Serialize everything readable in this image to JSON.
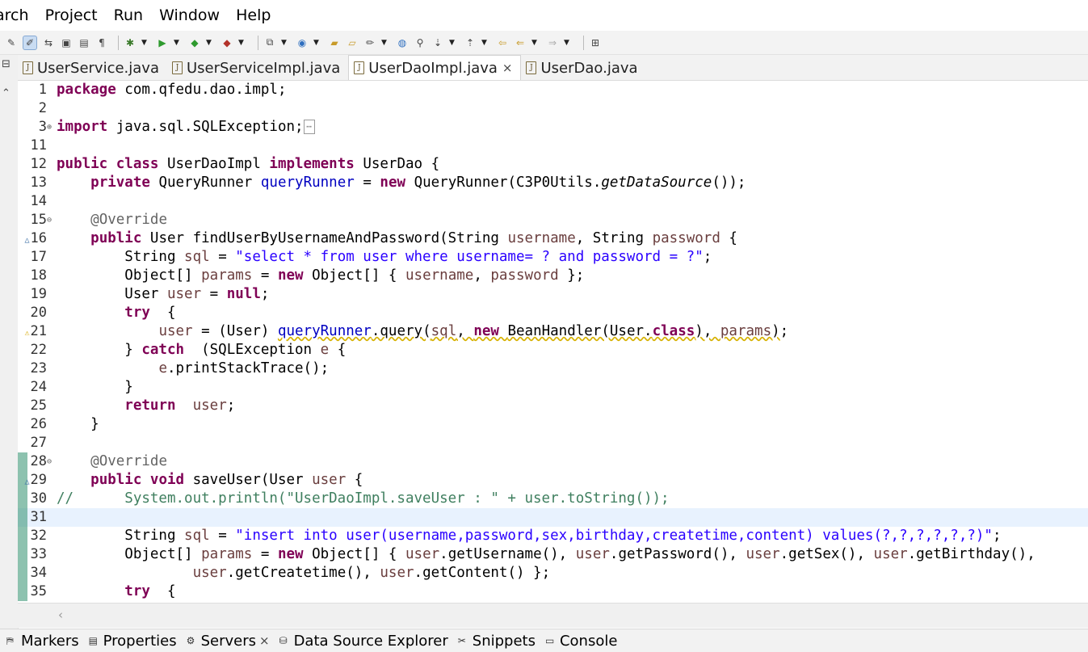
{
  "menu": {
    "items": [
      "arch",
      "Project",
      "Run",
      "Window",
      "Help"
    ]
  },
  "tabs": [
    {
      "label": "UserService.java",
      "active": false
    },
    {
      "label": "UserServiceImpl.java",
      "active": false
    },
    {
      "label": "UserDaoImpl.java",
      "active": true,
      "closable": true
    },
    {
      "label": "UserDao.java",
      "active": false
    }
  ],
  "code": [
    {
      "n": "1",
      "segs": [
        [
          "kw",
          "package"
        ],
        [
          "",
          "com.qfedu.dao.impl;"
        ]
      ]
    },
    {
      "n": "2",
      "segs": []
    },
    {
      "n": "3",
      "fold": "⊕",
      "segs": [
        [
          "kw",
          "import"
        ],
        [
          "",
          "java.sql.SQLException;"
        ],
        [
          "box",
          "⋯"
        ]
      ]
    },
    {
      "n": "11",
      "segs": []
    },
    {
      "n": "12",
      "segs": [
        [
          "kw",
          "public class"
        ],
        [
          "",
          "UserDaoImpl "
        ],
        [
          "kw",
          "implements"
        ],
        [
          "",
          "UserDao {"
        ]
      ]
    },
    {
      "n": "13",
      "segs": [
        [
          "",
          "    "
        ],
        [
          "kw",
          "private"
        ],
        [
          "",
          "QueryRunner "
        ],
        [
          "fld",
          "queryRunner"
        ],
        [
          "",
          " = "
        ],
        [
          "kw",
          "new"
        ],
        [
          "",
          "QueryRunner(C3P0Utils."
        ],
        [
          "ital",
          "getDataSource"
        ],
        [
          "",
          "());"
        ]
      ]
    },
    {
      "n": "14",
      "segs": []
    },
    {
      "n": "15",
      "fold": "⊖",
      "segs": [
        [
          "",
          "    "
        ],
        [
          "ann",
          "@Override"
        ]
      ]
    },
    {
      "n": "16",
      "marker": "△",
      "segs": [
        [
          "",
          "    "
        ],
        [
          "kw",
          "public"
        ],
        [
          "",
          "User findUserByUsernameAndPassword(String "
        ],
        [
          "var",
          "username"
        ],
        [
          "",
          ", String "
        ],
        [
          "var",
          "password"
        ],
        [
          "",
          " {"
        ]
      ]
    },
    {
      "n": "17",
      "segs": [
        [
          "",
          "        String "
        ],
        [
          "var",
          "sql"
        ],
        [
          "",
          " = "
        ],
        [
          "str",
          "\"select * from user where username= ? and password = ?\""
        ],
        [
          "",
          ";"
        ]
      ]
    },
    {
      "n": "18",
      "segs": [
        [
          "",
          "        Object[] "
        ],
        [
          "var",
          "params"
        ],
        [
          "",
          " = "
        ],
        [
          "kw",
          "new"
        ],
        [
          "",
          "Object[] { "
        ],
        [
          "var",
          "username"
        ],
        [
          "",
          ", "
        ],
        [
          "var",
          "password"
        ],
        [
          "",
          " };"
        ]
      ]
    },
    {
      "n": "19",
      "segs": [
        [
          "",
          "        User "
        ],
        [
          "var",
          "user"
        ],
        [
          "",
          " = "
        ],
        [
          "kw",
          "null"
        ],
        [
          "",
          ";"
        ]
      ]
    },
    {
      "n": "20",
      "segs": [
        [
          "",
          "        "
        ],
        [
          "kw",
          "try"
        ],
        [
          "",
          " {"
        ]
      ]
    },
    {
      "n": "21",
      "marker": "⚠",
      "segs": [
        [
          "",
          "            "
        ],
        [
          "var",
          "user"
        ],
        [
          "",
          " = (User) "
        ],
        [
          "fldw",
          "queryRunner"
        ],
        [
          "w",
          ".query("
        ],
        [
          "varw",
          "sql"
        ],
        [
          "w",
          ", "
        ],
        [
          "kww",
          "new"
        ],
        [
          "w",
          "BeanHandler(User."
        ],
        [
          "kww",
          "class"
        ],
        [
          "w",
          "), "
        ],
        [
          "varw",
          "params"
        ],
        [
          "w",
          ")"
        ],
        [
          "",
          ";"
        ]
      ]
    },
    {
      "n": "22",
      "segs": [
        [
          "",
          "        } "
        ],
        [
          "kw",
          "catch"
        ],
        [
          "",
          " (SQLException "
        ],
        [
          "var",
          "e"
        ],
        [
          "",
          " {"
        ]
      ]
    },
    {
      "n": "23",
      "segs": [
        [
          "",
          "            "
        ],
        [
          "var",
          "e"
        ],
        [
          "",
          ".printStackTrace();"
        ]
      ]
    },
    {
      "n": "24",
      "segs": [
        [
          "",
          "        }"
        ]
      ]
    },
    {
      "n": "25",
      "segs": [
        [
          "",
          "        "
        ],
        [
          "kw",
          "return"
        ],
        [
          "",
          " "
        ],
        [
          "var",
          "user"
        ],
        [
          "",
          ";"
        ]
      ]
    },
    {
      "n": "26",
      "segs": [
        [
          "",
          "    }"
        ]
      ]
    },
    {
      "n": "27",
      "segs": []
    },
    {
      "n": "28",
      "fold": "⊖",
      "bar": true,
      "segs": [
        [
          "",
          "    "
        ],
        [
          "ann",
          "@Override"
        ]
      ]
    },
    {
      "n": "29",
      "marker": "△",
      "bar": true,
      "segs": [
        [
          "",
          "    "
        ],
        [
          "kw",
          "public void"
        ],
        [
          "",
          "saveUser(User "
        ],
        [
          "var",
          "user"
        ],
        [
          "",
          " {"
        ]
      ]
    },
    {
      "n": "30",
      "bar": true,
      "segs": [
        [
          "com",
          "//      System.out.println(\"UserDaoImpl.saveUser : \" + user.toString());"
        ]
      ]
    },
    {
      "n": "31",
      "bar": true,
      "current": true,
      "segs": []
    },
    {
      "n": "32",
      "bar": true,
      "segs": [
        [
          "",
          "        String "
        ],
        [
          "var",
          "sql"
        ],
        [
          "",
          " = "
        ],
        [
          "str",
          "\"insert into user(username,password,sex,birthday,createtime,content) values(?,?,?,?,?,?)\""
        ],
        [
          "",
          ";"
        ]
      ]
    },
    {
      "n": "33",
      "bar": true,
      "segs": [
        [
          "",
          "        Object[] "
        ],
        [
          "var",
          "params"
        ],
        [
          "",
          " = "
        ],
        [
          "kw",
          "new"
        ],
        [
          "",
          "Object[] { "
        ],
        [
          "var",
          "user"
        ],
        [
          "",
          ".getUsername(), "
        ],
        [
          "var",
          "user"
        ],
        [
          "",
          ".getPassword(), "
        ],
        [
          "var",
          "user"
        ],
        [
          "",
          ".getSex(), "
        ],
        [
          "var",
          "user"
        ],
        [
          "",
          ".getBirthday(),"
        ]
      ]
    },
    {
      "n": "34",
      "bar": true,
      "segs": [
        [
          "",
          "                "
        ],
        [
          "var",
          "user"
        ],
        [
          "",
          ".getCreatetime(), "
        ],
        [
          "var",
          "user"
        ],
        [
          "",
          ".getContent() };"
        ]
      ]
    },
    {
      "n": "35",
      "bar": true,
      "segs": [
        [
          "",
          "        "
        ],
        [
          "kw",
          "try"
        ],
        [
          "",
          " {"
        ]
      ]
    }
  ],
  "bottom_tabs": [
    {
      "label": "Markers",
      "icon": "markers-icon",
      "glyph": "⛿"
    },
    {
      "label": "Properties",
      "icon": "properties-icon",
      "glyph": "▤"
    },
    {
      "label": "Servers",
      "icon": "servers-icon",
      "glyph": "⚙",
      "closable": true
    },
    {
      "label": "Data Source Explorer",
      "icon": "database-icon",
      "glyph": "⛁"
    },
    {
      "label": "Snippets",
      "icon": "snippets-icon",
      "glyph": "✂"
    },
    {
      "label": "Console",
      "icon": "console-icon",
      "glyph": "▭"
    }
  ],
  "colors": {
    "keyword": "#7f0055",
    "string": "#2a00ff",
    "field": "#0000c0",
    "variable": "#6a3e3e",
    "annotation": "#646464",
    "comment": "#3f7f5f",
    "current_line": "#e8f2fe"
  }
}
